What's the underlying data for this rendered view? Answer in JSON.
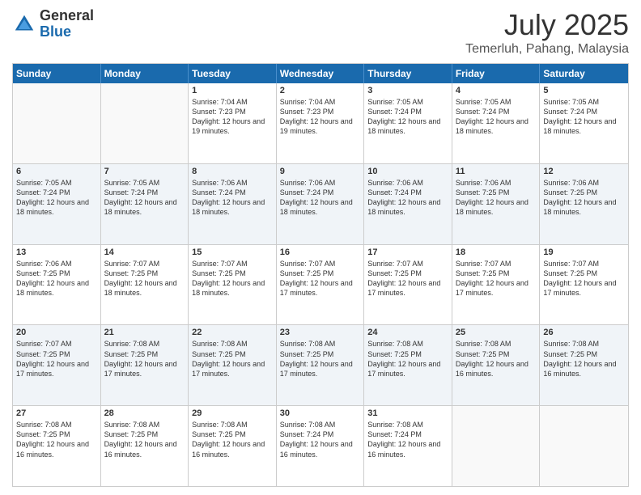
{
  "logo": {
    "general": "General",
    "blue": "Blue"
  },
  "title": "July 2025",
  "location": "Temerluh, Pahang, Malaysia",
  "weekdays": [
    "Sunday",
    "Monday",
    "Tuesday",
    "Wednesday",
    "Thursday",
    "Friday",
    "Saturday"
  ],
  "weeks": [
    [
      {
        "day": "",
        "sunrise": "",
        "sunset": "",
        "daylight": ""
      },
      {
        "day": "",
        "sunrise": "",
        "sunset": "",
        "daylight": ""
      },
      {
        "day": "1",
        "sunrise": "Sunrise: 7:04 AM",
        "sunset": "Sunset: 7:23 PM",
        "daylight": "Daylight: 12 hours and 19 minutes."
      },
      {
        "day": "2",
        "sunrise": "Sunrise: 7:04 AM",
        "sunset": "Sunset: 7:23 PM",
        "daylight": "Daylight: 12 hours and 19 minutes."
      },
      {
        "day": "3",
        "sunrise": "Sunrise: 7:05 AM",
        "sunset": "Sunset: 7:24 PM",
        "daylight": "Daylight: 12 hours and 18 minutes."
      },
      {
        "day": "4",
        "sunrise": "Sunrise: 7:05 AM",
        "sunset": "Sunset: 7:24 PM",
        "daylight": "Daylight: 12 hours and 18 minutes."
      },
      {
        "day": "5",
        "sunrise": "Sunrise: 7:05 AM",
        "sunset": "Sunset: 7:24 PM",
        "daylight": "Daylight: 12 hours and 18 minutes."
      }
    ],
    [
      {
        "day": "6",
        "sunrise": "Sunrise: 7:05 AM",
        "sunset": "Sunset: 7:24 PM",
        "daylight": "Daylight: 12 hours and 18 minutes."
      },
      {
        "day": "7",
        "sunrise": "Sunrise: 7:05 AM",
        "sunset": "Sunset: 7:24 PM",
        "daylight": "Daylight: 12 hours and 18 minutes."
      },
      {
        "day": "8",
        "sunrise": "Sunrise: 7:06 AM",
        "sunset": "Sunset: 7:24 PM",
        "daylight": "Daylight: 12 hours and 18 minutes."
      },
      {
        "day": "9",
        "sunrise": "Sunrise: 7:06 AM",
        "sunset": "Sunset: 7:24 PM",
        "daylight": "Daylight: 12 hours and 18 minutes."
      },
      {
        "day": "10",
        "sunrise": "Sunrise: 7:06 AM",
        "sunset": "Sunset: 7:24 PM",
        "daylight": "Daylight: 12 hours and 18 minutes."
      },
      {
        "day": "11",
        "sunrise": "Sunrise: 7:06 AM",
        "sunset": "Sunset: 7:25 PM",
        "daylight": "Daylight: 12 hours and 18 minutes."
      },
      {
        "day": "12",
        "sunrise": "Sunrise: 7:06 AM",
        "sunset": "Sunset: 7:25 PM",
        "daylight": "Daylight: 12 hours and 18 minutes."
      }
    ],
    [
      {
        "day": "13",
        "sunrise": "Sunrise: 7:06 AM",
        "sunset": "Sunset: 7:25 PM",
        "daylight": "Daylight: 12 hours and 18 minutes."
      },
      {
        "day": "14",
        "sunrise": "Sunrise: 7:07 AM",
        "sunset": "Sunset: 7:25 PM",
        "daylight": "Daylight: 12 hours and 18 minutes."
      },
      {
        "day": "15",
        "sunrise": "Sunrise: 7:07 AM",
        "sunset": "Sunset: 7:25 PM",
        "daylight": "Daylight: 12 hours and 18 minutes."
      },
      {
        "day": "16",
        "sunrise": "Sunrise: 7:07 AM",
        "sunset": "Sunset: 7:25 PM",
        "daylight": "Daylight: 12 hours and 17 minutes."
      },
      {
        "day": "17",
        "sunrise": "Sunrise: 7:07 AM",
        "sunset": "Sunset: 7:25 PM",
        "daylight": "Daylight: 12 hours and 17 minutes."
      },
      {
        "day": "18",
        "sunrise": "Sunrise: 7:07 AM",
        "sunset": "Sunset: 7:25 PM",
        "daylight": "Daylight: 12 hours and 17 minutes."
      },
      {
        "day": "19",
        "sunrise": "Sunrise: 7:07 AM",
        "sunset": "Sunset: 7:25 PM",
        "daylight": "Daylight: 12 hours and 17 minutes."
      }
    ],
    [
      {
        "day": "20",
        "sunrise": "Sunrise: 7:07 AM",
        "sunset": "Sunset: 7:25 PM",
        "daylight": "Daylight: 12 hours and 17 minutes."
      },
      {
        "day": "21",
        "sunrise": "Sunrise: 7:08 AM",
        "sunset": "Sunset: 7:25 PM",
        "daylight": "Daylight: 12 hours and 17 minutes."
      },
      {
        "day": "22",
        "sunrise": "Sunrise: 7:08 AM",
        "sunset": "Sunset: 7:25 PM",
        "daylight": "Daylight: 12 hours and 17 minutes."
      },
      {
        "day": "23",
        "sunrise": "Sunrise: 7:08 AM",
        "sunset": "Sunset: 7:25 PM",
        "daylight": "Daylight: 12 hours and 17 minutes."
      },
      {
        "day": "24",
        "sunrise": "Sunrise: 7:08 AM",
        "sunset": "Sunset: 7:25 PM",
        "daylight": "Daylight: 12 hours and 17 minutes."
      },
      {
        "day": "25",
        "sunrise": "Sunrise: 7:08 AM",
        "sunset": "Sunset: 7:25 PM",
        "daylight": "Daylight: 12 hours and 16 minutes."
      },
      {
        "day": "26",
        "sunrise": "Sunrise: 7:08 AM",
        "sunset": "Sunset: 7:25 PM",
        "daylight": "Daylight: 12 hours and 16 minutes."
      }
    ],
    [
      {
        "day": "27",
        "sunrise": "Sunrise: 7:08 AM",
        "sunset": "Sunset: 7:25 PM",
        "daylight": "Daylight: 12 hours and 16 minutes."
      },
      {
        "day": "28",
        "sunrise": "Sunrise: 7:08 AM",
        "sunset": "Sunset: 7:25 PM",
        "daylight": "Daylight: 12 hours and 16 minutes."
      },
      {
        "day": "29",
        "sunrise": "Sunrise: 7:08 AM",
        "sunset": "Sunset: 7:25 PM",
        "daylight": "Daylight: 12 hours and 16 minutes."
      },
      {
        "day": "30",
        "sunrise": "Sunrise: 7:08 AM",
        "sunset": "Sunset: 7:24 PM",
        "daylight": "Daylight: 12 hours and 16 minutes."
      },
      {
        "day": "31",
        "sunrise": "Sunrise: 7:08 AM",
        "sunset": "Sunset: 7:24 PM",
        "daylight": "Daylight: 12 hours and 16 minutes."
      },
      {
        "day": "",
        "sunrise": "",
        "sunset": "",
        "daylight": ""
      },
      {
        "day": "",
        "sunrise": "",
        "sunset": "",
        "daylight": ""
      }
    ]
  ]
}
